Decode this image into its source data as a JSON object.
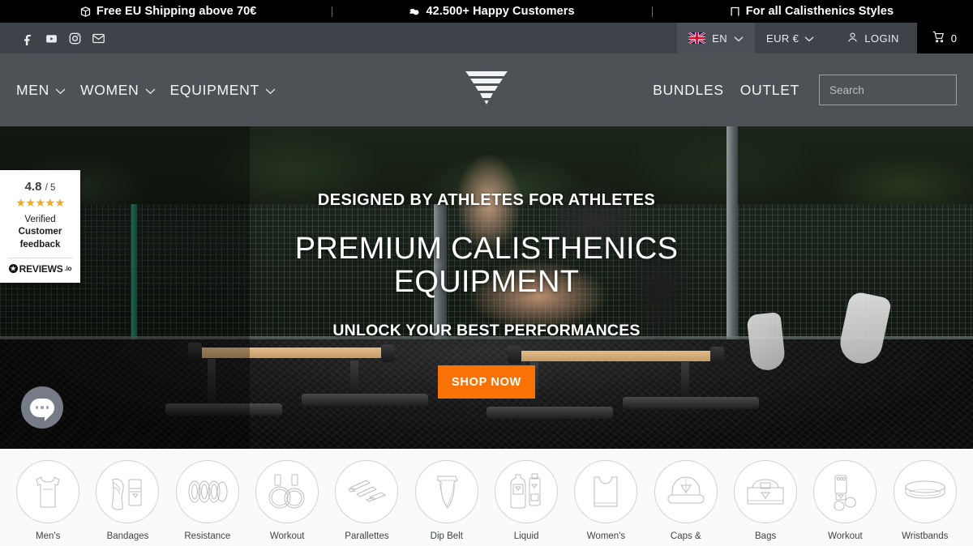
{
  "announcement": {
    "items": [
      {
        "icon": "package-icon",
        "text": "Free EU Shipping above 70€"
      },
      {
        "icon": "bicep-icon",
        "text": "42.500+ Happy Customers"
      },
      {
        "icon": "pullup-bar-icon",
        "text": "For all Calisthenics Styles"
      }
    ]
  },
  "utility": {
    "social": [
      {
        "icon": "facebook-icon",
        "label": "Facebook"
      },
      {
        "icon": "youtube-icon",
        "label": "YouTube"
      },
      {
        "icon": "instagram-icon",
        "label": "Instagram"
      },
      {
        "icon": "email-icon",
        "label": "Email"
      }
    ],
    "language": "EN",
    "currency": "EUR €",
    "login_label": "LOGIN",
    "cart_count": "0"
  },
  "nav": {
    "left": [
      {
        "label": "MEN",
        "has_dropdown": true
      },
      {
        "label": "WOMEN",
        "has_dropdown": true
      },
      {
        "label": "EQUIPMENT",
        "has_dropdown": true
      }
    ],
    "right": [
      {
        "label": "BUNDLES"
      },
      {
        "label": "OUTLET"
      }
    ],
    "logo_name": "inverted-triangle-logo"
  },
  "search": {
    "placeholder": "Search",
    "value": ""
  },
  "reviews_badge": {
    "score": "4.8",
    "out_of": "/ 5",
    "stars": "★★★★★",
    "star_color": "#F5A623",
    "line1": "Verified",
    "line2": "Customer",
    "line3": "feedback",
    "brand": "REVIEWS",
    "brand_suffix": ".io"
  },
  "hero": {
    "kicker": "DESIGNED BY ATHLETES FOR ATHLETES",
    "title": "PREMIUM CALISTHENICS EQUIPMENT",
    "subtitle": "UNLOCK YOUR BEST PERFORMANCES",
    "cta_label": "SHOP NOW",
    "cta_color": "#F97206"
  },
  "chat": {
    "name": "chat-widget"
  },
  "categories": [
    {
      "label": "Men's",
      "icon": "tank-top-icon"
    },
    {
      "label": "Bandages",
      "icon": "knee-sleeve-icon"
    },
    {
      "label": "Resistance",
      "icon": "resistance-bands-icon"
    },
    {
      "label": "Workout",
      "icon": "gymnastic-rings-icon"
    },
    {
      "label": "Parallettes",
      "icon": "parallettes-icon"
    },
    {
      "label": "Dip Belt",
      "icon": "dip-belt-icon"
    },
    {
      "label": "Liquid",
      "icon": "liquid-chalk-icon"
    },
    {
      "label": "Women's",
      "icon": "sports-bra-icon"
    },
    {
      "label": "Caps &",
      "icon": "cap-icon"
    },
    {
      "label": "Bags",
      "icon": "duffel-bag-icon"
    },
    {
      "label": "Workout",
      "icon": "grips-icon"
    },
    {
      "label": "Wristbands",
      "icon": "wristband-icon"
    }
  ]
}
